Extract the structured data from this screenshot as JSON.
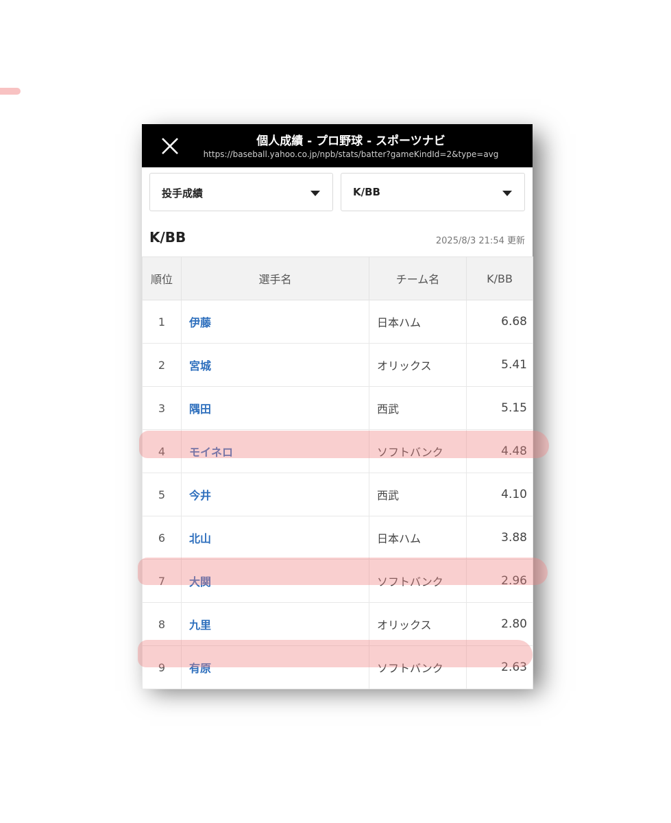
{
  "browser": {
    "title": "個人成績 - プロ野球 - スポーツナビ",
    "url": "https://baseball.yahoo.co.jp/npb/stats/batter?gameKindId=2&type=avg"
  },
  "filters": {
    "category": "投手成績",
    "stat": "K/BB"
  },
  "section": {
    "title": "K/BB",
    "updated": "2025/8/3 21:54 更新"
  },
  "table": {
    "headers": [
      "順位",
      "選手名",
      "チーム名",
      "K/BB"
    ],
    "rows": [
      {
        "rank": "1",
        "name": "伊藤",
        "team": "日本ハム",
        "value": "6.68",
        "highlighted": false
      },
      {
        "rank": "2",
        "name": "宮城",
        "team": "オリックス",
        "value": "5.41",
        "highlighted": false
      },
      {
        "rank": "3",
        "name": "隅田",
        "team": "西武",
        "value": "5.15",
        "highlighted": false
      },
      {
        "rank": "4",
        "name": "モイネロ",
        "team": "ソフトバンク",
        "value": "4.48",
        "highlighted": true
      },
      {
        "rank": "5",
        "name": "今井",
        "team": "西武",
        "value": "4.10",
        "highlighted": false
      },
      {
        "rank": "6",
        "name": "北山",
        "team": "日本ハム",
        "value": "3.88",
        "highlighted": false
      },
      {
        "rank": "7",
        "name": "大関",
        "team": "ソフトバンク",
        "value": "2.96",
        "highlighted": true
      },
      {
        "rank": "8",
        "name": "九里",
        "team": "オリックス",
        "value": "2.80",
        "highlighted": false
      },
      {
        "rank": "9",
        "name": "有原",
        "team": "ソフトバンク",
        "value": "2.63",
        "highlighted": true
      }
    ]
  },
  "colors": {
    "topbar": "#000000",
    "link": "#2e6fbd",
    "highlight": "#f08282"
  }
}
